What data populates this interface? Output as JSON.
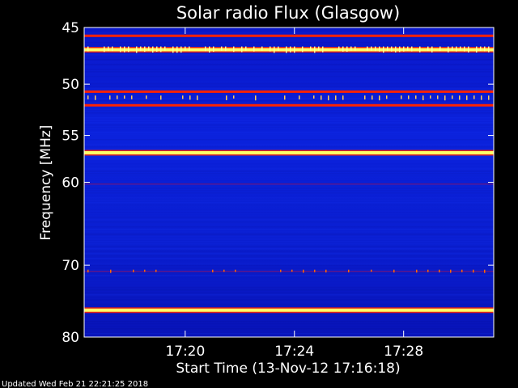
{
  "chart_data": {
    "type": "heatmap",
    "title": "Solar radio Flux (Glasgow)",
    "xlabel": "Start Time (13-Nov-12 17:16:18)",
    "ylabel": "Frequency [MHz]",
    "x_ticks": [
      "17:20",
      "17:24",
      "17:28"
    ],
    "x_tick_seconds_after_start": [
      222,
      462,
      702
    ],
    "x_range_seconds_after_start": [
      0,
      900
    ],
    "y_ticks": [
      45,
      50,
      55,
      60,
      70,
      80
    ],
    "ylim": [
      45,
      80
    ],
    "y_scale": "log",
    "colormap": "blue-red-yellow",
    "bands": [
      {
        "freq_mhz": 45.7,
        "level": "high"
      },
      {
        "freq_mhz": 46.9,
        "level": "very high"
      },
      {
        "freq_mhz": 50.7,
        "level": "high"
      },
      {
        "freq_mhz": 52.0,
        "level": "high"
      },
      {
        "freq_mhz": 56.8,
        "level": "very high"
      },
      {
        "freq_mhz": 60.2,
        "level": "moderate"
      },
      {
        "freq_mhz": 70.8,
        "level": "moderate"
      },
      {
        "freq_mhz": 76.1,
        "level": "very high"
      }
    ]
  },
  "footer": "Updated Wed Feb 21 22:21:25 2018",
  "colors": {
    "background": "#000000",
    "plot_base": "#0a1fd6",
    "high": "#ff2200",
    "very_high": "#ffff66"
  }
}
